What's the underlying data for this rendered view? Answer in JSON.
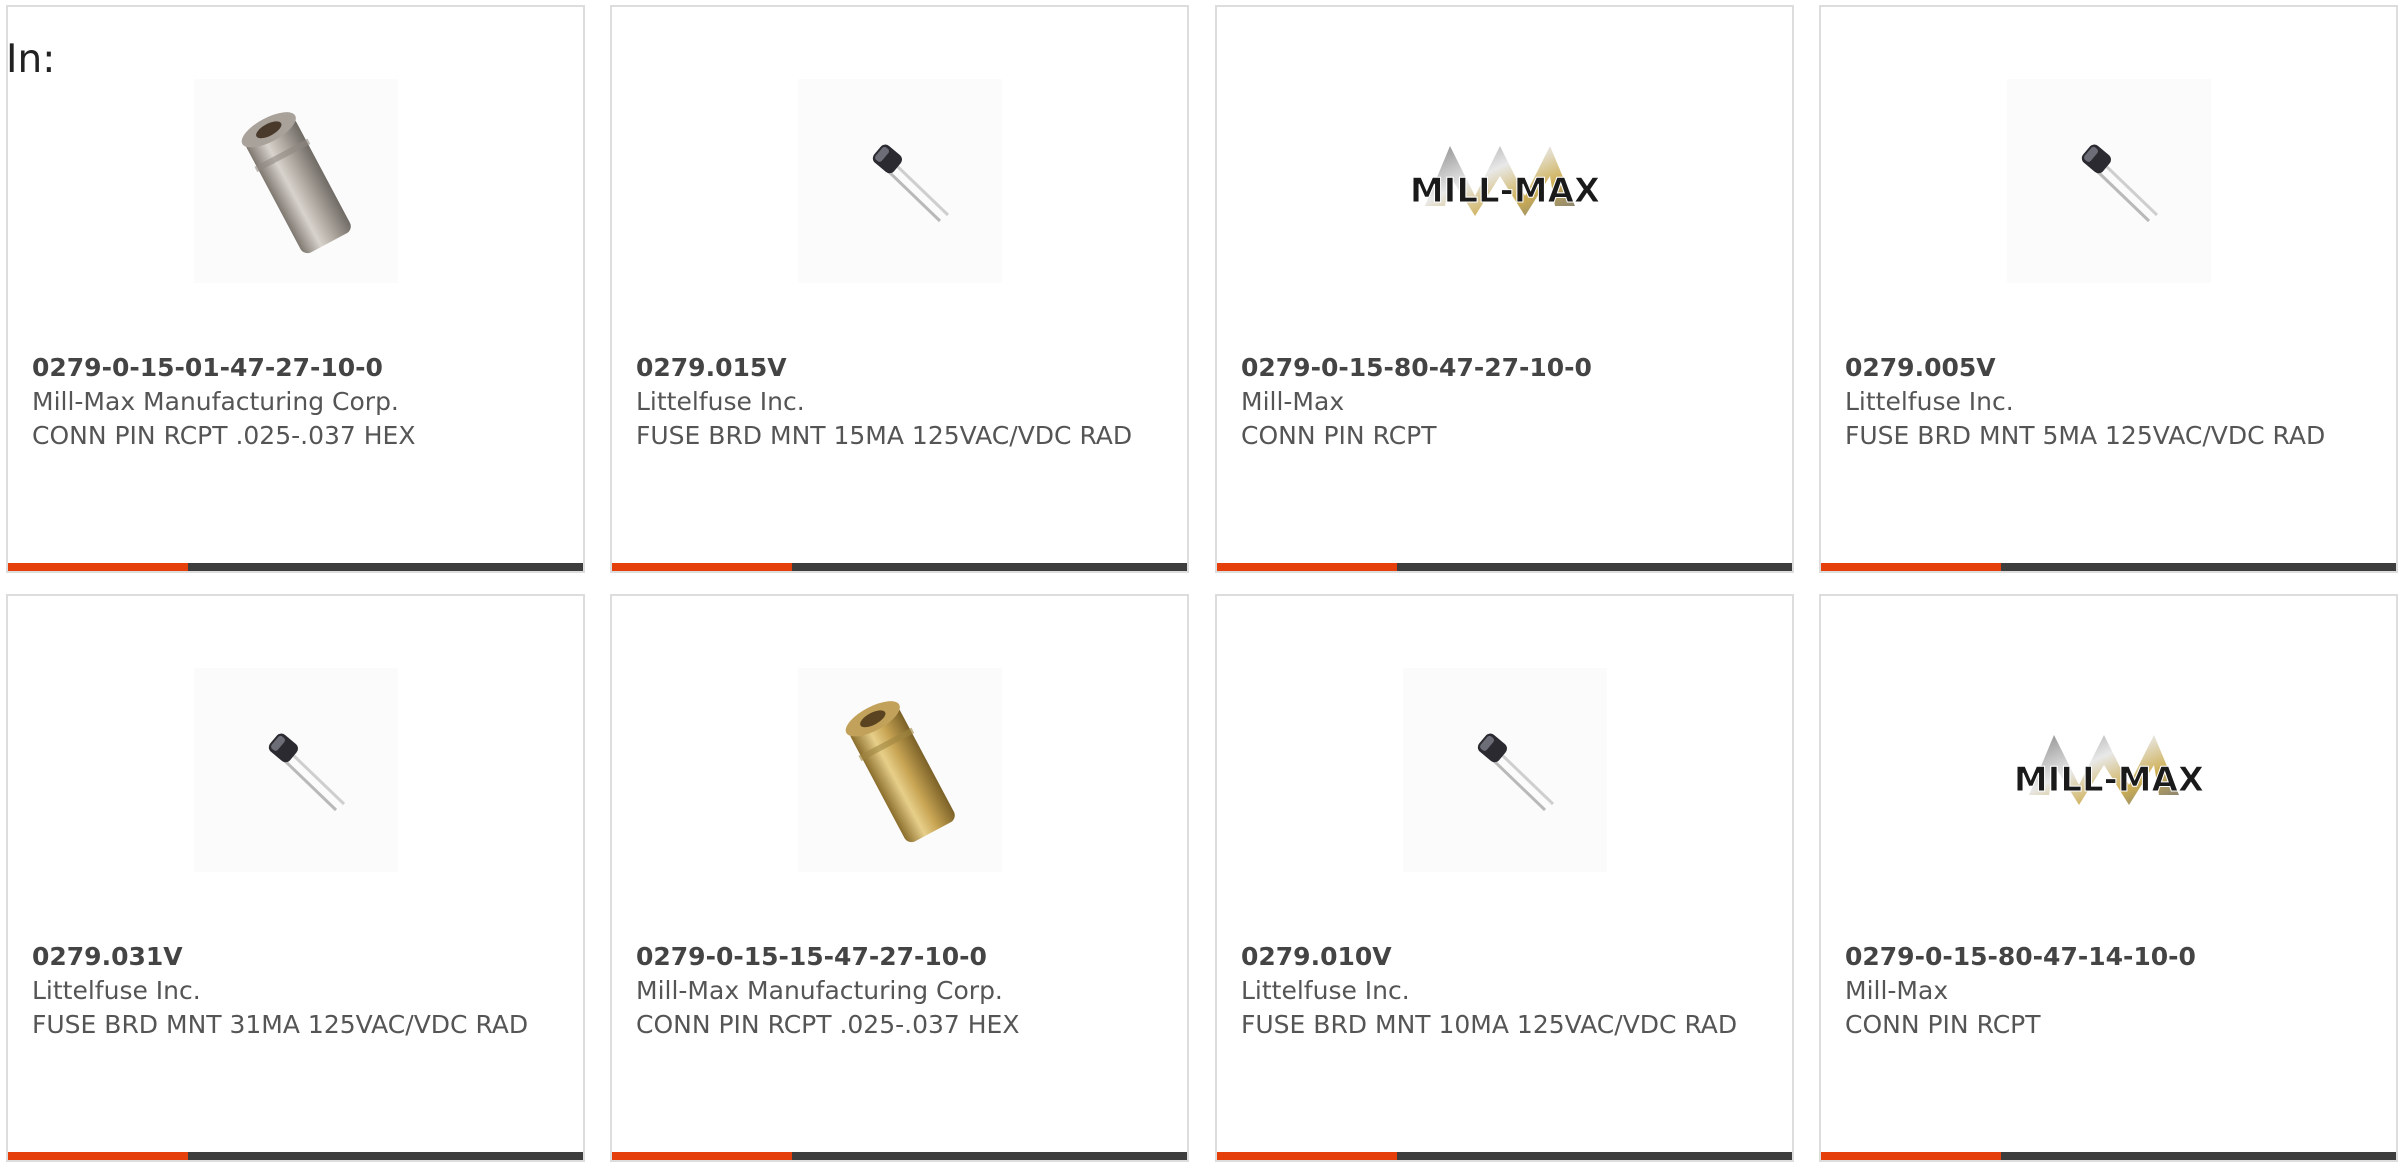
{
  "header": {
    "in_label": "In:"
  },
  "products": [
    {
      "part": "0279-0-15-01-47-27-10-0",
      "manufacturer": "Mill-Max Manufacturing Corp.",
      "description": "CONN PIN RCPT .025-.037 HEX",
      "image": "silver-pin-receptacle"
    },
    {
      "part": "0279.015V",
      "manufacturer": "Littelfuse Inc.",
      "description": "FUSE BRD MNT 15MA 125VAC/VDC RAD",
      "image": "radial-fuse"
    },
    {
      "part": "0279-0-15-80-47-27-10-0",
      "manufacturer": "Mill-Max",
      "description": "CONN PIN RCPT",
      "image": "mill-max-logo"
    },
    {
      "part": "0279.005V",
      "manufacturer": "Littelfuse Inc.",
      "description": "FUSE BRD MNT 5MA 125VAC/VDC RAD",
      "image": "radial-fuse"
    },
    {
      "part": "0279.031V",
      "manufacturer": "Littelfuse Inc.",
      "description": "FUSE BRD MNT 31MA 125VAC/VDC RAD",
      "image": "radial-fuse"
    },
    {
      "part": "0279-0-15-15-47-27-10-0",
      "manufacturer": "Mill-Max Manufacturing Corp.",
      "description": "CONN PIN RCPT .025-.037 HEX",
      "image": "gold-pin-receptacle"
    },
    {
      "part": "0279.010V",
      "manufacturer": "Littelfuse Inc.",
      "description": "FUSE BRD MNT 10MA 125VAC/VDC RAD",
      "image": "radial-fuse"
    },
    {
      "part": "0279-0-15-80-47-14-10-0",
      "manufacturer": "Mill-Max",
      "description": "CONN PIN RCPT",
      "image": "mill-max-logo"
    }
  ],
  "colors": {
    "accent": "#e5400c",
    "bar": "#3d3d3d",
    "border": "#dddddd",
    "text": "#555555"
  }
}
